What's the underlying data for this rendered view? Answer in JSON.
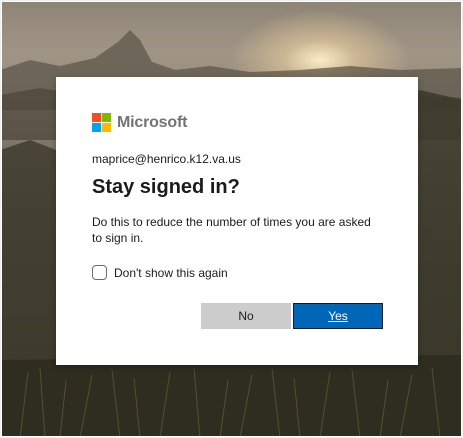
{
  "brand": {
    "name": "Microsoft",
    "logo_colors": [
      "#f25022",
      "#7fba00",
      "#00a4ef",
      "#ffb900"
    ]
  },
  "dialog": {
    "account": "maprice@henrico.k12.va.us",
    "title": "Stay signed in?",
    "description": "Do this to reduce the number of times you are asked to sign in.",
    "checkbox": {
      "label": "Don't show this again",
      "checked": false
    },
    "buttons": {
      "no_label": "No",
      "yes_label": "Yes"
    }
  },
  "colors": {
    "primary": "#0067b8",
    "secondary_button": "#cccccc",
    "text": "#1b1b1b",
    "brand_text": "#737373"
  }
}
